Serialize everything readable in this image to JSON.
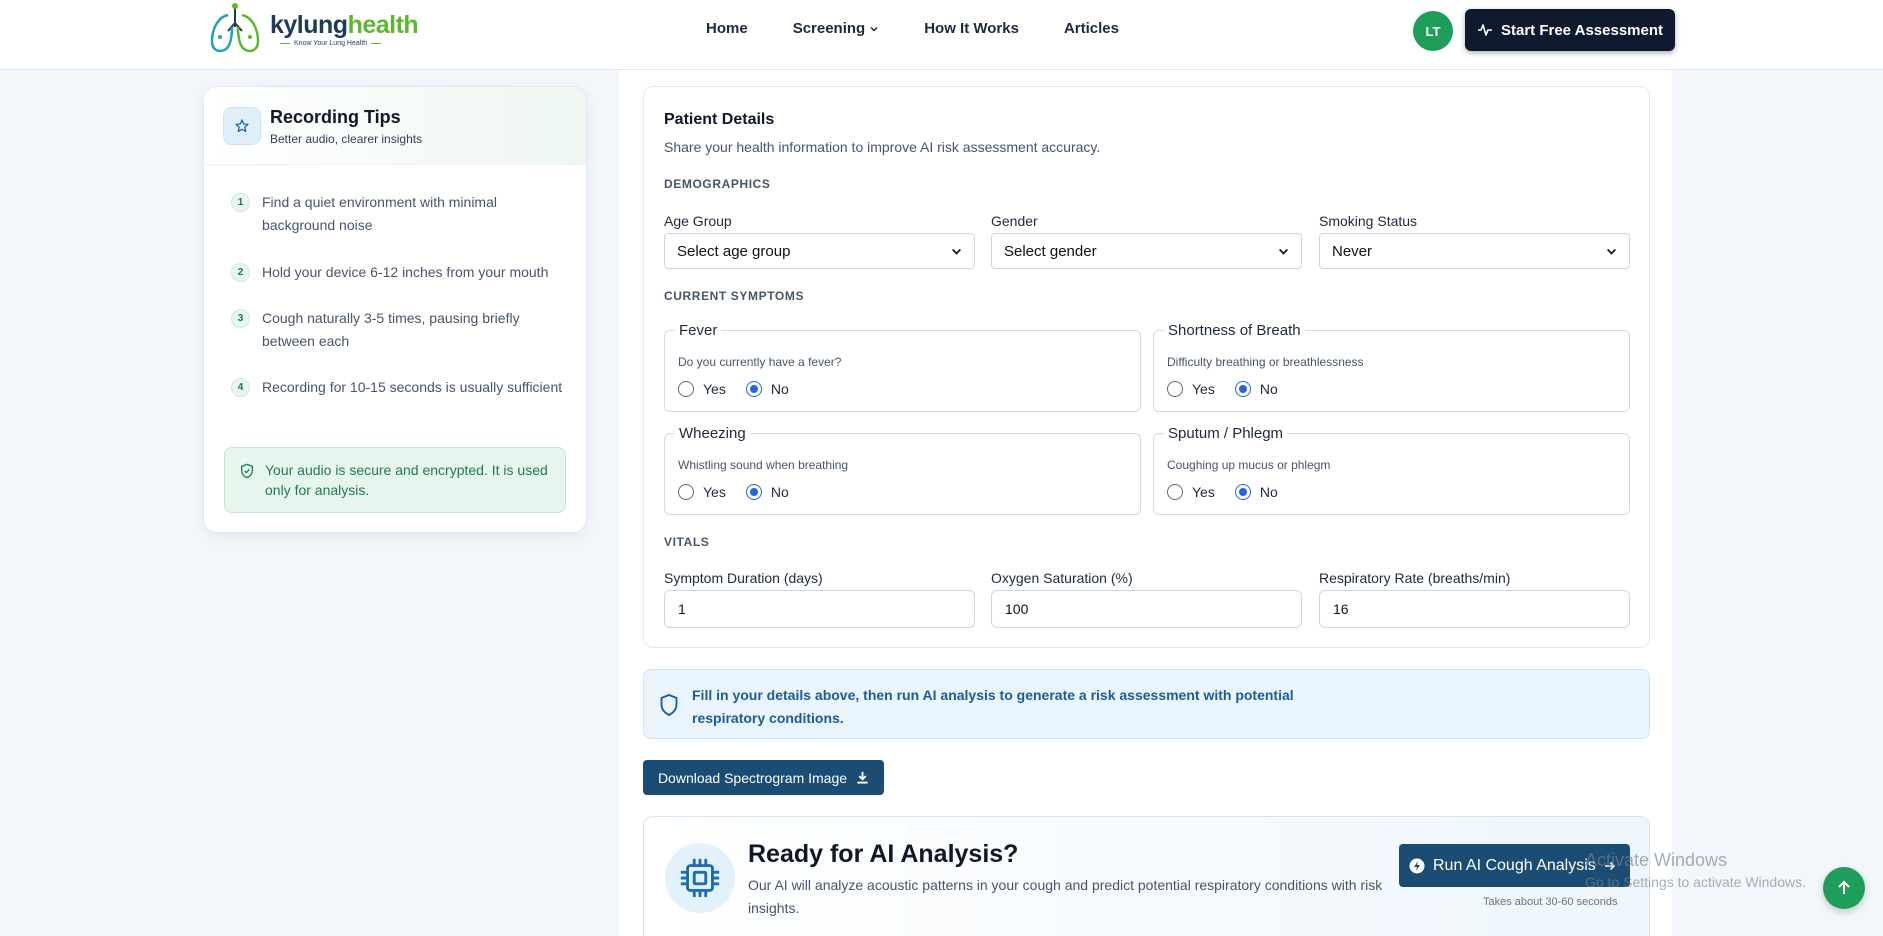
{
  "header": {
    "logo": {
      "name_part1": "kylung",
      "name_part2": "health",
      "tagline": "Know Your Lung Health"
    },
    "nav": [
      {
        "label": "Home"
      },
      {
        "label": "Screening"
      },
      {
        "label": "How It Works"
      },
      {
        "label": "Articles"
      }
    ],
    "avatar_initials": "LT",
    "cta_label": "Start Free Assessment"
  },
  "tips": {
    "title": "Recording Tips",
    "subtitle": "Better audio, clearer insights",
    "items": [
      {
        "num": "1",
        "text": "Find a quiet environment with minimal background noise"
      },
      {
        "num": "2",
        "text": "Hold your device 6-12 inches from your mouth"
      },
      {
        "num": "3",
        "text": "Cough naturally 3-5 times, pausing briefly between each"
      },
      {
        "num": "4",
        "text": "Recording for 10-15 seconds is usually sufficient"
      }
    ],
    "secure_note": "Your audio is secure and encrypted. It is used only for analysis."
  },
  "patient": {
    "title": "Patient Details",
    "subtitle": "Share your health information to improve AI risk assessment accuracy.",
    "demographics_label": "DEMOGRAPHICS",
    "age": {
      "label": "Age Group",
      "value": "Select age group"
    },
    "gender": {
      "label": "Gender",
      "value": "Select gender"
    },
    "smoking": {
      "label": "Smoking Status",
      "value": "Never"
    },
    "symptoms_label": "CURRENT SYMPTOMS",
    "yes_label": "Yes",
    "no_label": "No",
    "symptoms": [
      {
        "name": "Fever",
        "desc": "Do you currently have a fever?",
        "selected": "No"
      },
      {
        "name": "Shortness of Breath",
        "desc": "Difficulty breathing or breathlessness",
        "selected": "No"
      },
      {
        "name": "Wheezing",
        "desc": "Whistling sound when breathing",
        "selected": "No"
      },
      {
        "name": "Sputum / Phlegm",
        "desc": "Coughing up mucus or phlegm",
        "selected": "No"
      }
    ],
    "vitals_label": "VITALS",
    "duration": {
      "label": "Symptom Duration (days)",
      "value": "1"
    },
    "oxygen": {
      "label": "Oxygen Saturation (%)",
      "value": "100"
    },
    "resp": {
      "label": "Respiratory Rate (breaths/min)",
      "value": "16"
    }
  },
  "info_banner": "Fill in your details above, then run AI analysis to generate a risk assessment with potential respiratory conditions.",
  "download_label": "Download Spectrogram Image",
  "ready": {
    "title": "Ready for AI Analysis?",
    "desc": "Our AI will analyze acoustic patterns in your cough and predict potential respiratory conditions with risk insights.",
    "run_label": "Run AI Cough Analysis",
    "note": "Takes about 30-60 seconds"
  },
  "watermark": {
    "line1": "Activate Windows",
    "line2": "Go to Settings to activate Windows."
  },
  "colors": {
    "brand_dark": "#0f1a2f",
    "brand_green": "#1e9e5a",
    "button_blue": "#1b4d74",
    "radio_blue": "#2563eb"
  }
}
